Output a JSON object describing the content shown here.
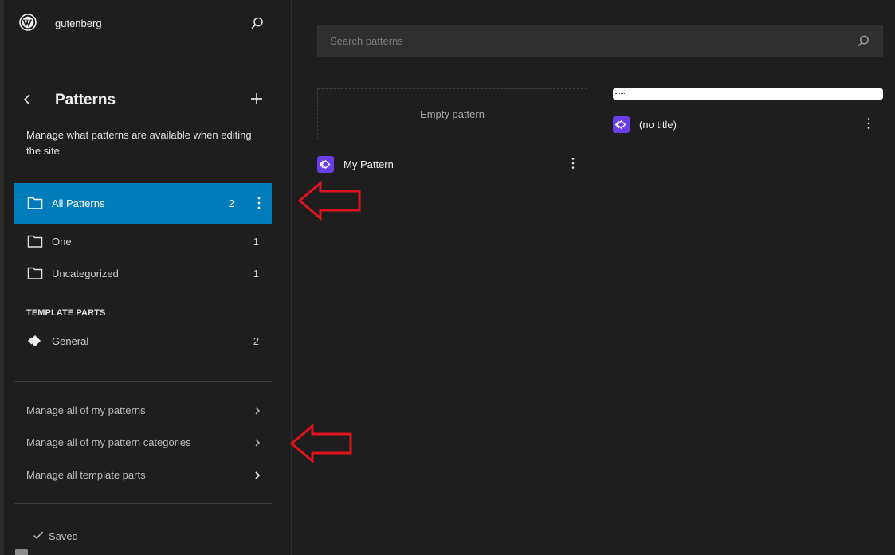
{
  "sidebar": {
    "site_name": "gutenberg",
    "title": "Patterns",
    "description": "Manage what patterns are available when editing the site.",
    "categories": [
      {
        "label": "All Patterns",
        "count": "2",
        "active": true
      },
      {
        "label": "One",
        "count": "1",
        "active": false
      },
      {
        "label": "Uncategorized",
        "count": "1",
        "active": false
      }
    ],
    "template_parts_heading": "TEMPLATE PARTS",
    "template_parts": [
      {
        "label": "General",
        "count": "2"
      }
    ],
    "manage_links": [
      {
        "label": "Manage all of my patterns"
      },
      {
        "label": "Manage all of my pattern categories"
      },
      {
        "label": "Manage all template parts"
      }
    ],
    "status": "Saved"
  },
  "main": {
    "search_placeholder": "Search patterns",
    "patterns": [
      {
        "preview_text": "Empty pattern",
        "title": "My Pattern"
      },
      {
        "preview_text": "",
        "title": "(no title)"
      }
    ]
  },
  "colors": {
    "accent": "#007cba",
    "badge": "#6a3ee8",
    "annotation_arrow": "#e0141e"
  },
  "icons": [
    "wordpress-logo-icon",
    "search-icon",
    "back-chevron-icon",
    "plus-icon",
    "folder-icon",
    "kebab-menu-icon",
    "template-part-icon",
    "chevron-right-icon",
    "check-icon",
    "pattern-icon"
  ]
}
